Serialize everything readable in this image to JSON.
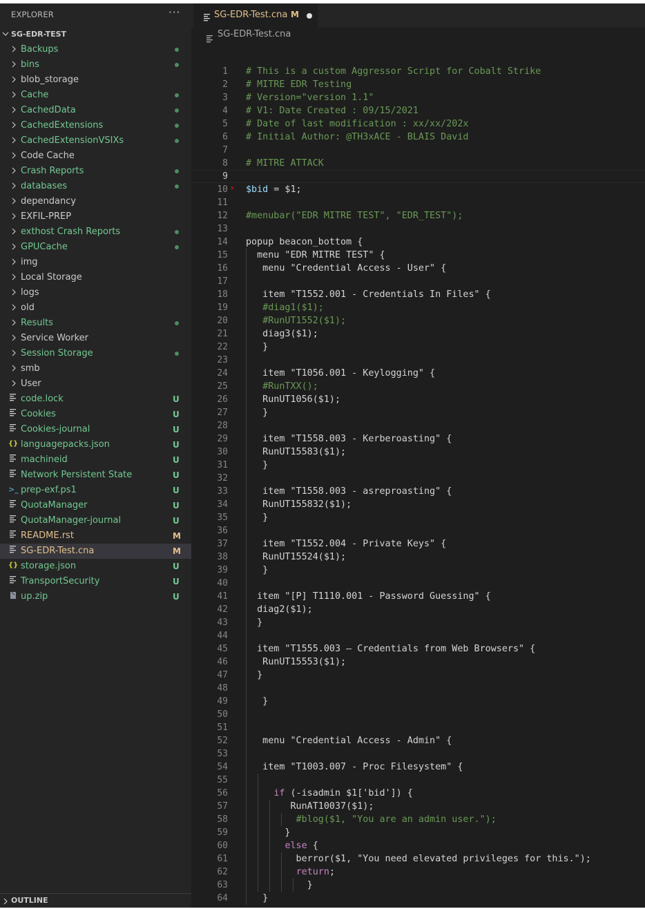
{
  "sidebar": {
    "title": "EXPLORER",
    "more_icon": "more-icon",
    "workspace": "SG-EDR-TEST",
    "outline_label": "OUTLINE",
    "items": [
      {
        "name": "Backups",
        "kind": "folder",
        "color": "#73c991",
        "dot": true
      },
      {
        "name": "bins",
        "kind": "folder",
        "color": "#73c991",
        "dot": true
      },
      {
        "name": "blob_storage",
        "kind": "folder",
        "color": "#cccccc"
      },
      {
        "name": "Cache",
        "kind": "folder",
        "color": "#73c991",
        "dot": true
      },
      {
        "name": "CachedData",
        "kind": "folder",
        "color": "#73c991",
        "dot": true
      },
      {
        "name": "CachedExtensions",
        "kind": "folder",
        "color": "#73c991",
        "dot": true
      },
      {
        "name": "CachedExtensionVSIXs",
        "kind": "folder",
        "color": "#73c991",
        "dot": true
      },
      {
        "name": "Code Cache",
        "kind": "folder",
        "color": "#cccccc"
      },
      {
        "name": "Crash Reports",
        "kind": "folder",
        "color": "#73c991",
        "dot": true
      },
      {
        "name": "databases",
        "kind": "folder",
        "color": "#73c991",
        "dot": true
      },
      {
        "name": "dependancy",
        "kind": "folder",
        "color": "#cccccc"
      },
      {
        "name": "EXFIL-PREP",
        "kind": "folder",
        "color": "#cccccc"
      },
      {
        "name": "exthost Crash Reports",
        "kind": "folder",
        "color": "#73c991",
        "dot": true
      },
      {
        "name": "GPUCache",
        "kind": "folder",
        "color": "#73c991",
        "dot": true
      },
      {
        "name": "img",
        "kind": "folder",
        "color": "#cccccc"
      },
      {
        "name": "Local Storage",
        "kind": "folder",
        "color": "#cccccc"
      },
      {
        "name": "logs",
        "kind": "folder",
        "color": "#cccccc"
      },
      {
        "name": "old",
        "kind": "folder",
        "color": "#cccccc"
      },
      {
        "name": "Results",
        "kind": "folder",
        "color": "#73c991",
        "dot": true
      },
      {
        "name": "Service Worker",
        "kind": "folder",
        "color": "#cccccc"
      },
      {
        "name": "Session Storage",
        "kind": "folder",
        "color": "#73c991",
        "dot": true
      },
      {
        "name": "smb",
        "kind": "folder",
        "color": "#cccccc"
      },
      {
        "name": "User",
        "kind": "folder",
        "color": "#cccccc"
      },
      {
        "name": "code.lock",
        "kind": "file",
        "icon": "lines",
        "color": "#73c991",
        "badge": "U"
      },
      {
        "name": "Cookies",
        "kind": "file",
        "icon": "lines",
        "color": "#73c991",
        "badge": "U"
      },
      {
        "name": "Cookies-journal",
        "kind": "file",
        "icon": "lines",
        "color": "#73c991",
        "badge": "U"
      },
      {
        "name": "languagepacks.json",
        "kind": "file",
        "icon": "json",
        "color": "#73c991",
        "badge": "U"
      },
      {
        "name": "machineid",
        "kind": "file",
        "icon": "lines",
        "color": "#73c991",
        "badge": "U"
      },
      {
        "name": "Network Persistent State",
        "kind": "file",
        "icon": "lines",
        "color": "#73c991",
        "badge": "U"
      },
      {
        "name": "prep-exf.ps1",
        "kind": "file",
        "icon": "ps",
        "color": "#73c991",
        "badge": "U"
      },
      {
        "name": "QuotaManager",
        "kind": "file",
        "icon": "lines",
        "color": "#73c991",
        "badge": "U"
      },
      {
        "name": "QuotaManager-journal",
        "kind": "file",
        "icon": "lines",
        "color": "#73c991",
        "badge": "U"
      },
      {
        "name": "README.rst",
        "kind": "file",
        "icon": "lines",
        "color": "#e2c08d",
        "badge": "M"
      },
      {
        "name": "SG-EDR-Test.cna",
        "kind": "file",
        "icon": "lines",
        "color": "#e2c08d",
        "badge": "M",
        "selected": true
      },
      {
        "name": "storage.json",
        "kind": "file",
        "icon": "json",
        "color": "#73c991",
        "badge": "U"
      },
      {
        "name": "TransportSecurity",
        "kind": "file",
        "icon": "lines",
        "color": "#73c991",
        "badge": "U"
      },
      {
        "name": "up.zip",
        "kind": "file",
        "icon": "zip",
        "color": "#73c991",
        "badge": "U"
      }
    ]
  },
  "tab": {
    "name": "SG-EDR-Test.cna",
    "status": "M"
  },
  "breadcrumb": {
    "file": "SG-EDR-Test.cna"
  },
  "editor": {
    "active_line": 9,
    "lines": [
      {
        "n": 1,
        "indent": 0,
        "tokens": [
          [
            "c",
            "# This is a custom Aggressor Script for Cobalt Strike"
          ]
        ]
      },
      {
        "n": 2,
        "indent": 0,
        "tokens": [
          [
            "c",
            "# MITRE EDR Testing"
          ]
        ]
      },
      {
        "n": 3,
        "indent": 0,
        "tokens": [
          [
            "c",
            "# Version=\"version 1.1\""
          ]
        ]
      },
      {
        "n": 4,
        "indent": 0,
        "tokens": [
          [
            "c",
            "# V1: Date Created : 09/15/2021"
          ]
        ]
      },
      {
        "n": 5,
        "indent": 0,
        "tokens": [
          [
            "c",
            "# Date of last modification : xx/xx/202x"
          ]
        ]
      },
      {
        "n": 6,
        "indent": 0,
        "tokens": [
          [
            "c",
            "# Initial Author: @TH3xACE - BLAIS David"
          ]
        ]
      },
      {
        "n": 7,
        "indent": 0,
        "tokens": []
      },
      {
        "n": 8,
        "indent": 0,
        "tokens": [
          [
            "c",
            "# MITRE ATTACK"
          ]
        ]
      },
      {
        "n": 9,
        "indent": 0,
        "tokens": []
      },
      {
        "n": 10,
        "indent": 0,
        "marker": true,
        "tokens": [
          [
            "v",
            "$bid"
          ],
          [
            "t",
            " = $1;"
          ]
        ]
      },
      {
        "n": 11,
        "indent": 0,
        "tokens": []
      },
      {
        "n": 12,
        "indent": 0,
        "tokens": [
          [
            "c",
            "#menubar(\"EDR MITRE TEST\", \"EDR_TEST\");"
          ]
        ]
      },
      {
        "n": 13,
        "indent": 0,
        "tokens": []
      },
      {
        "n": 14,
        "indent": 0,
        "tokens": [
          [
            "t",
            "popup beacon_bottom {"
          ]
        ]
      },
      {
        "n": 15,
        "indent": 1,
        "tokens": [
          [
            "t",
            "  menu \"EDR MITRE TEST\" {"
          ]
        ]
      },
      {
        "n": 16,
        "indent": 1,
        "tokens": [
          [
            "t",
            "   menu \"Credential Access - User\" {"
          ]
        ]
      },
      {
        "n": 17,
        "indent": 1,
        "tokens": []
      },
      {
        "n": 18,
        "indent": 1,
        "tokens": [
          [
            "t",
            "   item \"T1552.001 - Credentials In Files\" {"
          ]
        ]
      },
      {
        "n": 19,
        "indent": 1,
        "tokens": [
          [
            "t",
            "   "
          ],
          [
            "c",
            "#diag1($1);"
          ]
        ]
      },
      {
        "n": 20,
        "indent": 1,
        "tokens": [
          [
            "t",
            "   "
          ],
          [
            "c",
            "#RunUT1552($1);"
          ]
        ]
      },
      {
        "n": 21,
        "indent": 1,
        "tokens": [
          [
            "t",
            "   diag3($1);"
          ]
        ]
      },
      {
        "n": 22,
        "indent": 1,
        "tokens": [
          [
            "t",
            "   }"
          ]
        ]
      },
      {
        "n": 23,
        "indent": 1,
        "tokens": []
      },
      {
        "n": 24,
        "indent": 1,
        "tokens": [
          [
            "t",
            "   item \"T1056.001 - Keylogging\" {"
          ]
        ]
      },
      {
        "n": 25,
        "indent": 1,
        "tokens": [
          [
            "t",
            "   "
          ],
          [
            "c",
            "#RunTXX();"
          ]
        ]
      },
      {
        "n": 26,
        "indent": 1,
        "tokens": [
          [
            "t",
            "   RunUT1056($1);"
          ]
        ]
      },
      {
        "n": 27,
        "indent": 1,
        "tokens": [
          [
            "t",
            "   }"
          ]
        ]
      },
      {
        "n": 28,
        "indent": 1,
        "tokens": []
      },
      {
        "n": 29,
        "indent": 1,
        "tokens": [
          [
            "t",
            "   item \"T1558.003 - Kerberoasting\" {"
          ]
        ]
      },
      {
        "n": 30,
        "indent": 1,
        "tokens": [
          [
            "t",
            "   RunUT15583($1);"
          ]
        ]
      },
      {
        "n": 31,
        "indent": 1,
        "tokens": [
          [
            "t",
            "   }"
          ]
        ]
      },
      {
        "n": 32,
        "indent": 1,
        "tokens": []
      },
      {
        "n": 33,
        "indent": 1,
        "tokens": [
          [
            "t",
            "   item \"T1558.003 - asreproasting\" {"
          ]
        ]
      },
      {
        "n": 34,
        "indent": 1,
        "tokens": [
          [
            "t",
            "   RunUT155832($1);"
          ]
        ]
      },
      {
        "n": 35,
        "indent": 1,
        "tokens": [
          [
            "t",
            "   }"
          ]
        ]
      },
      {
        "n": 36,
        "indent": 1,
        "tokens": []
      },
      {
        "n": 37,
        "indent": 1,
        "tokens": [
          [
            "t",
            "   item \"T1552.004 - Private Keys\" {"
          ]
        ]
      },
      {
        "n": 38,
        "indent": 1,
        "tokens": [
          [
            "t",
            "   RunUT15524($1);"
          ]
        ]
      },
      {
        "n": 39,
        "indent": 1,
        "tokens": [
          [
            "t",
            "   }"
          ]
        ]
      },
      {
        "n": 40,
        "indent": 1,
        "tokens": []
      },
      {
        "n": 41,
        "indent": 1,
        "tokens": [
          [
            "t",
            "  item \"[P] T1110.001 - Password Guessing\" {"
          ]
        ]
      },
      {
        "n": 42,
        "indent": 1,
        "tokens": [
          [
            "t",
            "  diag2($1);"
          ]
        ]
      },
      {
        "n": 43,
        "indent": 1,
        "tokens": [
          [
            "t",
            "  }"
          ]
        ]
      },
      {
        "n": 44,
        "indent": 1,
        "tokens": []
      },
      {
        "n": 45,
        "indent": 1,
        "tokens": [
          [
            "t",
            "  item \"T1555.003 – Credentials from Web Browsers\" {"
          ]
        ]
      },
      {
        "n": 46,
        "indent": 1,
        "tokens": [
          [
            "t",
            "   RunUT15553($1);"
          ]
        ]
      },
      {
        "n": 47,
        "indent": 1,
        "tokens": [
          [
            "t",
            "  }"
          ]
        ]
      },
      {
        "n": 48,
        "indent": 1,
        "tokens": []
      },
      {
        "n": 49,
        "indent": 1,
        "tokens": [
          [
            "t",
            "   }"
          ]
        ]
      },
      {
        "n": 50,
        "indent": 1,
        "tokens": []
      },
      {
        "n": 51,
        "indent": 1,
        "tokens": []
      },
      {
        "n": 52,
        "indent": 1,
        "tokens": [
          [
            "t",
            "   menu \"Credential Access - Admin\" {"
          ]
        ]
      },
      {
        "n": 53,
        "indent": 1,
        "tokens": []
      },
      {
        "n": 54,
        "indent": 1,
        "tokens": [
          [
            "t",
            "   item \"T1003.007 - Proc Filesystem\" {"
          ]
        ]
      },
      {
        "n": 55,
        "indent": 2,
        "tokens": []
      },
      {
        "n": 56,
        "indent": 2,
        "tokens": [
          [
            "t",
            "     "
          ],
          [
            "k",
            "if"
          ],
          [
            "t",
            " (-isadmin $1['bid']) {"
          ]
        ]
      },
      {
        "n": 57,
        "indent": 3,
        "tokens": [
          [
            "t",
            "        RunAT10037($1);"
          ]
        ]
      },
      {
        "n": 58,
        "indent": 4,
        "tokens": [
          [
            "t",
            "         "
          ],
          [
            "c",
            "#blog($1, \"You are an admin user.\");"
          ]
        ]
      },
      {
        "n": 59,
        "indent": 3,
        "tokens": [
          [
            "t",
            "       }"
          ]
        ]
      },
      {
        "n": 60,
        "indent": 3,
        "tokens": [
          [
            "t",
            "       "
          ],
          [
            "k",
            "else"
          ],
          [
            "t",
            " {"
          ]
        ]
      },
      {
        "n": 61,
        "indent": 4,
        "tokens": [
          [
            "t",
            "         berror($1, \"You need elevated privileges for this.\");"
          ]
        ]
      },
      {
        "n": 62,
        "indent": 4,
        "tokens": [
          [
            "t",
            "         "
          ],
          [
            "k",
            "return"
          ],
          [
            "t",
            ";"
          ]
        ]
      },
      {
        "n": 63,
        "indent": 5,
        "tokens": [
          [
            "t",
            "           }"
          ]
        ]
      },
      {
        "n": 64,
        "indent": 1,
        "tokens": [
          [
            "t",
            "   }"
          ]
        ]
      }
    ]
  }
}
